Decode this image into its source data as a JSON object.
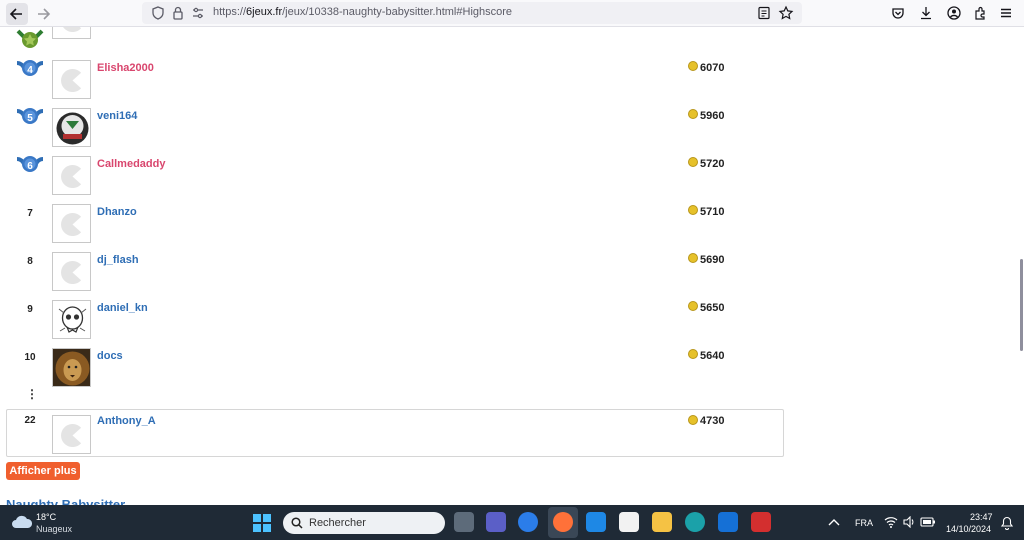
{
  "browser": {
    "url_prefix": "https://",
    "url_domain": "6jeux.fr",
    "url_path": "/jeux/10338-naughty-babysitter.html#Highscore"
  },
  "leaderboard": {
    "rows": [
      {
        "rank": "4",
        "player": "Elisha2000",
        "score": "6070"
      },
      {
        "rank": "5",
        "player": "veni164",
        "score": "5960"
      },
      {
        "rank": "6",
        "player": "Callmedaddy",
        "score": "5720"
      },
      {
        "rank": "7",
        "player": "Dhanzo",
        "score": "5710"
      },
      {
        "rank": "8",
        "player": "dj_flash",
        "score": "5690"
      },
      {
        "rank": "9",
        "player": "daniel_kn",
        "score": "5650"
      },
      {
        "rank": "10",
        "player": "docs",
        "score": "5640"
      }
    ],
    "ellipsis": "⋮",
    "current_user": {
      "rank": "22",
      "player": "Anthony_A",
      "score": "4730"
    },
    "more_button": "Afficher plus",
    "heading": "Naughty Babysitter",
    "colors": {
      "player_link": "#2f6eb5",
      "player_pink": "#d9466e",
      "more_button": "#f05f2e"
    }
  },
  "taskbar": {
    "weather_temp": "18°C",
    "weather_desc": "Nuageux",
    "search_placeholder": "Rechercher",
    "language": "FRA",
    "time": "23:47",
    "date": "14/10/2024"
  }
}
